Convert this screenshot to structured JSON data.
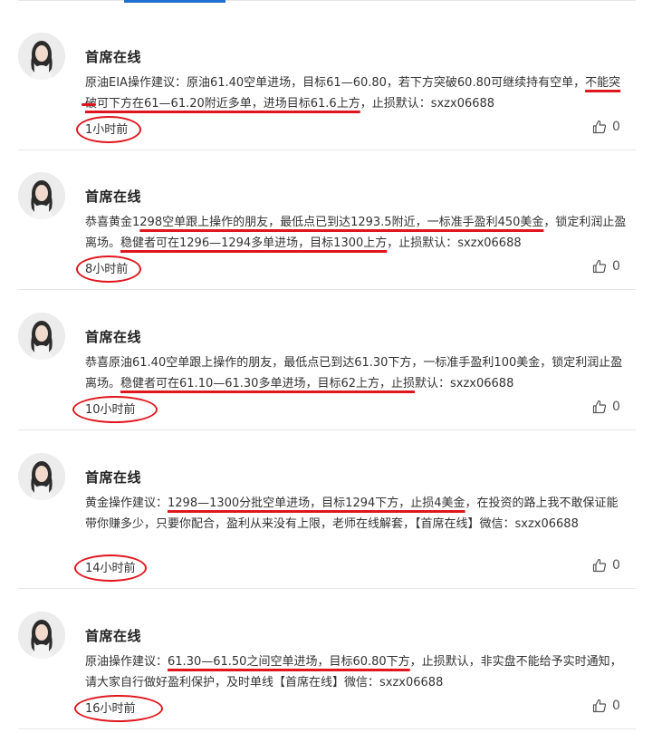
{
  "posts": [
    {
      "author": "首席在线",
      "content_segments": [
        {
          "text": "原油EIA操作建议：原油61.40空单进场，目标61—60.80，若下方突破60.80可继续持有空单，",
          "underline": false
        },
        {
          "text": "不能突破可下方在61—61.20附近多单，进场目标61.6上方",
          "underline": true
        },
        {
          "text": "，止损默认：sxzx06688",
          "underline": false
        }
      ],
      "time": "1小时前",
      "likes": "0"
    },
    {
      "author": "首席在线",
      "content_segments": [
        {
          "text": "恭喜黄金1",
          "underline": false
        },
        {
          "text": "298空单跟上操作的朋友，最低点已到达1293.5附近，一标准手盈利450美金",
          "underline": true
        },
        {
          "text": "，锁定利润止盈离场。",
          "underline": false
        },
        {
          "text": "稳健者可在1296—1294多单进场，目标1300上方",
          "underline": true
        },
        {
          "text": "，止损默认：sxzx06688",
          "underline": false
        }
      ],
      "time": "8小时前",
      "likes": "0"
    },
    {
      "author": "首席在线",
      "content_segments": [
        {
          "text": "恭喜原油61.40空单跟上操作的朋友，最低点已到达61.30下方，一标准手盈利100美金，锁定利润止盈离场。",
          "underline": false
        },
        {
          "text": "稳健者可在61.10—61.30多单进场，目标62上方，止损",
          "underline": true
        },
        {
          "text": "默认：sxzx06688",
          "underline": false
        }
      ],
      "time": "10小时前",
      "likes": "0"
    },
    {
      "author": "首席在线",
      "content_segments": [
        {
          "text": "黄金操作建议：",
          "underline": false
        },
        {
          "text": "1298—1300分批空单进场，目标1294下方，止损4美金",
          "underline": true
        },
        {
          "text": "，在投资的路上我不敢保证能带你赚多少，只要你配合，盈利从来没有上限，老师在线解套，【首席在线】微信：sxzx06688",
          "underline": false
        }
      ],
      "time": "14小时前",
      "likes": "0"
    },
    {
      "author": "首席在线",
      "content_segments": [
        {
          "text": "原油操作建议：",
          "underline": false
        },
        {
          "text": "61.30—61.50之间空单进场，目标60.80下方",
          "underline": true
        },
        {
          "text": "，止损默认，非实盘不能给予实时通知，请大家自行做好盈利保护，及时单线【首席在线】微信：sxzx06688",
          "underline": false
        }
      ],
      "time": "16小时前",
      "likes": "0"
    }
  ],
  "colors": {
    "annotation_red": "#e0161e",
    "tab_accent_blue": "#1f6fd0",
    "divider": "#e6e6e6"
  },
  "icons": {
    "avatar": "woman-portrait",
    "like": "thumbs-up-icon"
  }
}
